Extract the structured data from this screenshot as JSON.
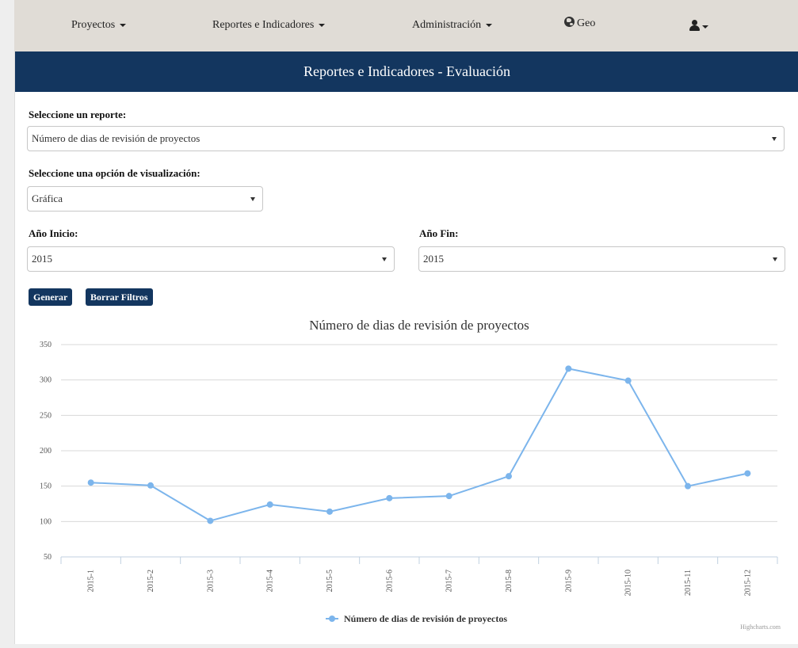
{
  "nav": {
    "items": [
      {
        "label": "Proyectos",
        "dropdown": true
      },
      {
        "label": "Reportes e Indicadores",
        "dropdown": true
      },
      {
        "label": "Administración",
        "dropdown": true
      }
    ],
    "geo_label": "Geo",
    "icons": {
      "geo": "globe-icon",
      "user": "user-icon"
    }
  },
  "panel": {
    "title": "Reportes e Indicadores - Evaluación"
  },
  "form": {
    "report_label": "Seleccione un reporte:",
    "report_value": "Número de dias de revisión de proyectos",
    "view_label": "Seleccione una opción de visualización:",
    "view_value": "Gráfica",
    "start_label": "Año Inicio:",
    "start_value": "2015",
    "end_label": "Año Fin:",
    "end_value": "2015",
    "generate_label": "Generar",
    "clear_label": "Borrar Filtros"
  },
  "colors": {
    "navbar": "#e0dcd6",
    "header": "#13365f",
    "series": "#7cb5ec"
  },
  "chart_data": {
    "type": "line",
    "title": "Número de dias de revisión de proyectos",
    "categories": [
      "2015-1",
      "2015-2",
      "2015-3",
      "2015-4",
      "2015-5",
      "2015-6",
      "2015-7",
      "2015-8",
      "2015-9",
      "2015-10",
      "2015-11",
      "2015-12"
    ],
    "series": [
      {
        "name": "Número de dias de revisión de proyectos",
        "values": [
          155,
          151,
          101,
          124,
          114,
          133,
          136,
          164,
          316,
          299,
          150,
          168
        ]
      }
    ],
    "ylim": [
      50,
      350
    ],
    "yticks": [
      350,
      300,
      250,
      200,
      150,
      100,
      50
    ],
    "grid": true,
    "legend": "bottom-center",
    "credits": "Highcharts.com"
  }
}
